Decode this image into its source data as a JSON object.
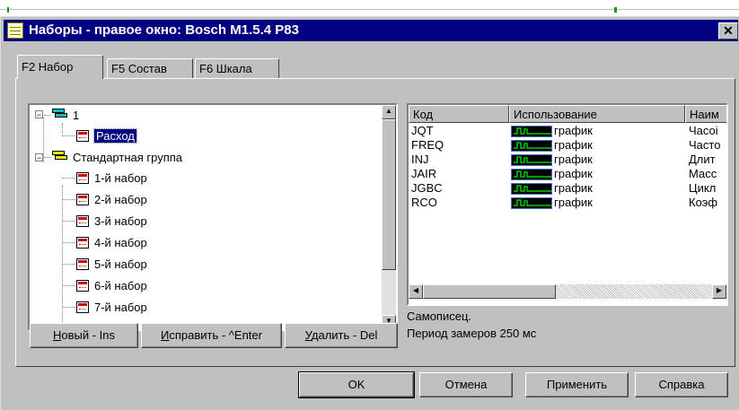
{
  "window": {
    "title": "Наборы - правое окно: Bosch M1.5.4 P83",
    "close_glyph": "✕"
  },
  "tabs": [
    {
      "label": "F2 Набор",
      "active": true
    },
    {
      "label": "F5 Состав",
      "active": false
    },
    {
      "label": "F6 Шкала",
      "active": false
    }
  ],
  "tree": {
    "items": [
      {
        "label": "1",
        "type": "group",
        "expander": "−"
      },
      {
        "label": "Расход",
        "type": "set",
        "selected": true
      },
      {
        "label": "Стандартная группа",
        "type": "group",
        "expander": "−"
      },
      {
        "label": "1-й набор",
        "type": "set"
      },
      {
        "label": "2-й набор",
        "type": "set"
      },
      {
        "label": "3-й набор",
        "type": "set"
      },
      {
        "label": "4-й набор",
        "type": "set"
      },
      {
        "label": "5-й набор",
        "type": "set"
      },
      {
        "label": "6-й набор",
        "type": "set"
      },
      {
        "label": "7-й набор",
        "type": "set"
      }
    ]
  },
  "tree_buttons": {
    "new": {
      "label": "Новый - Ins",
      "underline_char": "Н"
    },
    "edit": {
      "label": "Исправить - ^Enter",
      "underline_char": "И"
    },
    "delete": {
      "label": "Удалить - Del",
      "underline_char": "У"
    }
  },
  "list": {
    "columns": [
      "Код",
      "Использование",
      "Наим"
    ],
    "rows": [
      {
        "code": "JQT",
        "usage": "график",
        "name": "Часоі"
      },
      {
        "code": "FREQ",
        "usage": "график",
        "name": "Часто"
      },
      {
        "code": "INJ",
        "usage": "график",
        "name": "Длит"
      },
      {
        "code": "JAIR",
        "usage": "график",
        "name": "Масс"
      },
      {
        "code": "JGBC",
        "usage": "график",
        "name": "Цикл"
      },
      {
        "code": "RCO",
        "usage": "график",
        "name": "Коэф"
      }
    ]
  },
  "description": {
    "line1": "Самописец.",
    "line2": "Период замеров 250 мс"
  },
  "buttons": {
    "ok": "OK",
    "cancel": "Отмена",
    "apply": "Применить",
    "help": "Справка"
  },
  "colors": {
    "title_bar": "#000080",
    "selection": "#000080",
    "graph_wave": "#00cc00"
  }
}
